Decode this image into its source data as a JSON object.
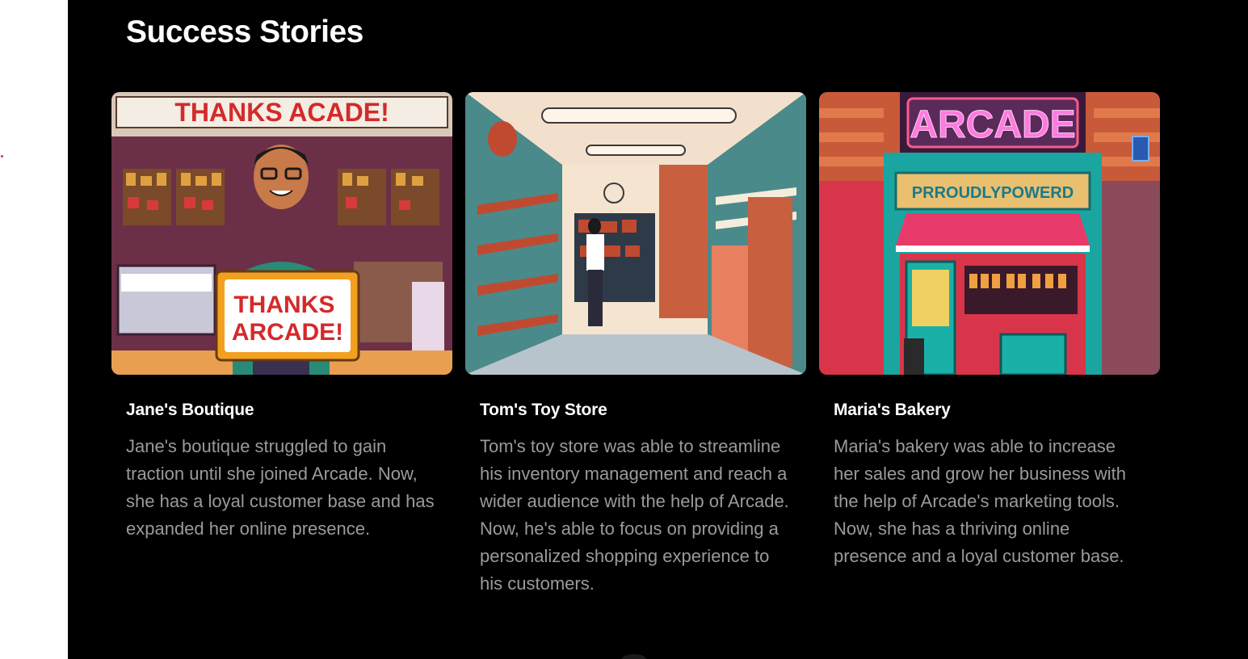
{
  "section": {
    "title": "Success Stories"
  },
  "stories": [
    {
      "title": "Jane's Boutique",
      "body": "Jane's boutique struggled to gain traction until she joined Arcade. Now, she has a loyal customer base and has expanded her online presence.",
      "image_text": {
        "banner": "THANKS ACADE!",
        "sign": "THANKS ARCADE!"
      }
    },
    {
      "title": "Tom's Toy Store",
      "body": "Tom's toy store was able to streamline his inventory management and reach a wider audience with the help of Arcade. Now, he's able to focus on providing a personalized shopping experience to his customers."
    },
    {
      "title": "Maria's Bakery",
      "body": "Maria's bakery was able to increase her sales and grow her business with the help of Arcade's marketing tools. Now, she has a thriving online presence and a loyal customer base.",
      "image_text": {
        "neon": "ARCADE",
        "sign": "PRROUDLYPOWERD"
      }
    }
  ]
}
